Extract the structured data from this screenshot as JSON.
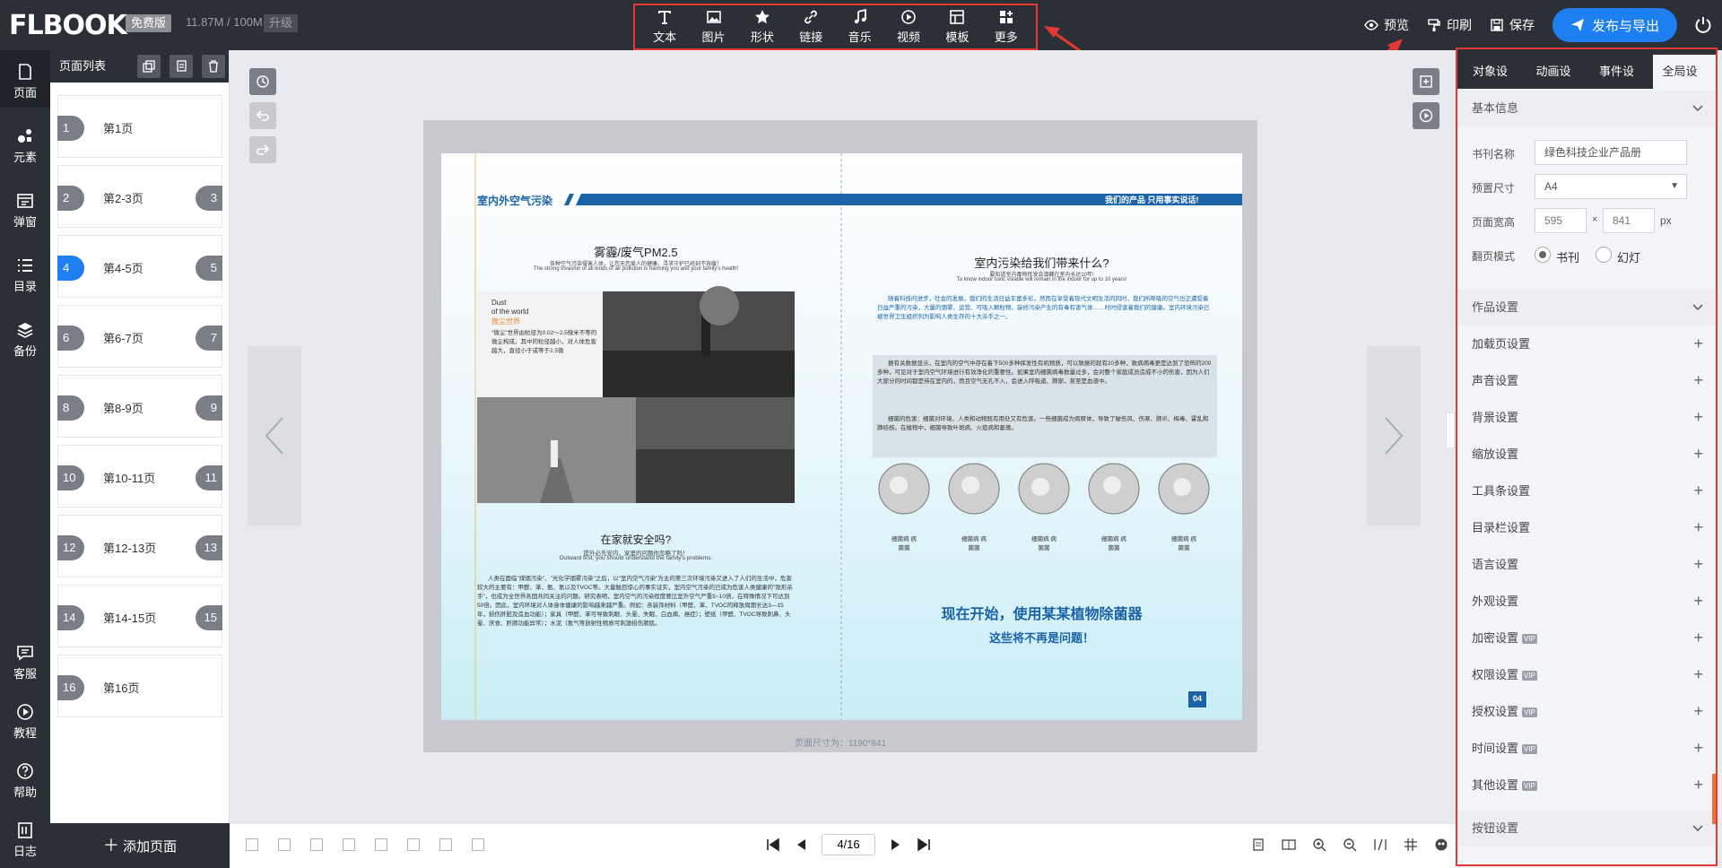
{
  "topbar": {
    "logo": "FLBOOK",
    "logo_mark": "®",
    "plan_badge": "免费版",
    "storage": "11.87M / 100M",
    "upgrade": "升级",
    "tools": [
      {
        "label": "文本",
        "icon": "text-icon"
      },
      {
        "label": "图片",
        "icon": "image-icon"
      },
      {
        "label": "形状",
        "icon": "star-icon"
      },
      {
        "label": "链接",
        "icon": "link-icon"
      },
      {
        "label": "音乐",
        "icon": "music-icon"
      },
      {
        "label": "视频",
        "icon": "play-circle-icon"
      },
      {
        "label": "模板",
        "icon": "template-icon"
      },
      {
        "label": "更多",
        "icon": "grid-plus-icon"
      }
    ],
    "preview": "预览",
    "print": "印刷",
    "save": "保存",
    "publish": "发布与导出"
  },
  "leftnav": [
    {
      "label": "页面",
      "icon": "page-icon"
    },
    {
      "label": "元素",
      "icon": "elements-icon"
    },
    {
      "label": "弹窗",
      "icon": "popup-icon"
    },
    {
      "label": "目录",
      "icon": "list-icon"
    },
    {
      "label": "备份",
      "icon": "layers-icon"
    },
    {
      "label": "客服",
      "icon": "chat-icon"
    },
    {
      "label": "教程",
      "icon": "play-icon"
    },
    {
      "label": "帮助",
      "icon": "help-icon"
    },
    {
      "label": "日志",
      "icon": "log-icon"
    }
  ],
  "pagelist": {
    "title": "页面列表",
    "pages": [
      {
        "n1": "1",
        "n2": "",
        "label": "第1页"
      },
      {
        "n1": "2",
        "n2": "3",
        "label": "第2-3页"
      },
      {
        "n1": "4",
        "n2": "5",
        "label": "第4-5页"
      },
      {
        "n1": "6",
        "n2": "7",
        "label": "第6-7页"
      },
      {
        "n1": "8",
        "n2": "9",
        "label": "第8-9页"
      },
      {
        "n1": "10",
        "n2": "11",
        "label": "第10-11页"
      },
      {
        "n1": "12",
        "n2": "13",
        "label": "第12-13页"
      },
      {
        "n1": "14",
        "n2": "15",
        "label": "第14-15页"
      },
      {
        "n1": "16",
        "n2": "",
        "label": "第16页"
      }
    ],
    "add_page": "添加页面"
  },
  "canvas": {
    "page_size_label": "页面尺寸为：1190*841",
    "left_page": {
      "header": "室内外空气污染",
      "h1": "雾霾/废气PM2.5",
      "h1_sub_cn": "各种空气污染侵害人体，让您无您爱人的健康，寻求守护已经刻不容缓！",
      "h1_sub_en": "The strong invasion of all kinds of air pollution is harming you and your family's health!",
      "dust_en1": "Dust",
      "dust_en2": "of the world",
      "dust_cn": "微尘世界",
      "dust_body": "\"微尘\"世界由粒径为0.02～2.5微米不等的微尘构成，其中的粒径越小，对人体危害越大，直径小于或等于2.5微",
      "h2": "在家就安全吗?",
      "h2_sub_cn": "提外必先安内，家里的问题你忽略了吗！",
      "h2_sub_en": "Outward first, you should understand the family's problems.",
      "body": "人类在面临\"煤烟污染\"、\"光化学烟雾污染\"之后，以\"室内空气污染\"为主的第三次环境污染又进入了人们的生活中，危害较大的主要有：甲醛、苯、氨、氡以及TVOC等。大量触目惊心的事实证实，室内空气污染的已成为危害人类健康的\"隐形杀手\"，也成为全世界各国共同关注的问题。研究表明，室内空气的污染程度要比室外空气严重5~10倍，在特殊情况下可达到50倍。因此，室内环境对人体身体健康的影响越来越严重。例如：各装饰材料（甲醛、苯、TVOC的释放周期长达3—15年，损伤肝脏及造血功能）；家具（甲醛、苯可导致刺眼、头晕、失眠、白血病、癌症）；壁纸（甲醛、TVOC导致刺鼻、头晕、厌食、肝肺功能异常）；水泥（氡气等放射性物质可刺激损伤肺肌。"
    },
    "right_page": {
      "header": "我们的产品 只用事实说话!",
      "h1": "室内污染给我们带来什么?",
      "h1_sub_cn": "要知道室内毒物挥发会潜藏在室内长达10年!",
      "h1_sub_en": "To know indoor toxic volatile will remain in the indoor for up to 10 years!",
      "p1": "随着科技的进步，社会的发展，我们的生活日益丰富多彩，然而在享受着现代文明生活的同时，我们所呼吸的空气也正遭受着日益严重的污染，大量的烟雾、运营、可吸入颗粒物、装修污染产生的有毒有害气体……时时侵害着我们的健康。室内环境污染已被世界卫生组织列为影响人类生存的十大杀手之一。",
      "p2": "据有关数据显示，在室内的空气中存在着下500多种挥发性有机物质，可以致癌的就有20多种，致病病毒更是达到了恐怖的200多种，可见对于室内空气环境进行有效净化的重要性。如果室内细菌病毒数量过多，会对整个家庭成员造成不小的伤害，因为人们大部分的时间都是待在室内的，而且空气无孔不入，会进入呼吸道、肺部，甚至是血液中。",
      "p3": "细菌的危害：细菌对环境、人类和动物既有用处又有危害。一些细菌成为病原体，导致了破伤风、伤寒、肺炎、梅毒、霍乱和肺结核。在植物中，细菌导致叶斑病、火疫病和萎蔫。",
      "icon_labels": [
        "细菌病 病菌菌",
        "细菌病 病菌菌",
        "细菌病 病菌菌",
        "细菌病 病菌菌",
        "细菌病 病菌菌"
      ],
      "cta1": "现在开始，使用某某植物除菌器",
      "cta2": "这些将不再是问题！",
      "page_no": "04"
    }
  },
  "bottombar": {
    "page_input": "4/16"
  },
  "rightpanel": {
    "tabs": [
      "对象设置",
      "动画设置",
      "事件设置",
      "全局设置"
    ],
    "active_tab": 3,
    "basic_info": "基本信息",
    "book_name_label": "书刊名称",
    "book_name_value": "绿色科技企业产品册",
    "preset_size_label": "预置尺寸",
    "preset_size_value": "A4",
    "page_wh_label": "页面宽高",
    "width": "595",
    "times": "×",
    "height": "841",
    "unit": "px",
    "flip_mode_label": "翻页模式",
    "flip_book": "书刊",
    "flip_slide": "幻灯",
    "work_settings": "作品设置",
    "items": [
      {
        "label": "加载页设置",
        "vip": ""
      },
      {
        "label": "声音设置",
        "vip": ""
      },
      {
        "label": "背景设置",
        "vip": ""
      },
      {
        "label": "缩放设置",
        "vip": ""
      },
      {
        "label": "工具条设置",
        "vip": ""
      },
      {
        "label": "目录栏设置",
        "vip": ""
      },
      {
        "label": "语言设置",
        "vip": ""
      },
      {
        "label": "外观设置",
        "vip": ""
      },
      {
        "label": "加密设置",
        "vip": "VIP"
      },
      {
        "label": "权限设置",
        "vip": "VIP"
      },
      {
        "label": "授权设置",
        "vip": "VIP"
      },
      {
        "label": "时间设置",
        "vip": "VIP"
      },
      {
        "label": "其他设置",
        "vip": "VIP"
      }
    ],
    "button_settings": "按钮设置"
  },
  "colors": {
    "accent": "#1e7ff0",
    "dark": "#2b2f36",
    "highlight": "#e53935"
  }
}
